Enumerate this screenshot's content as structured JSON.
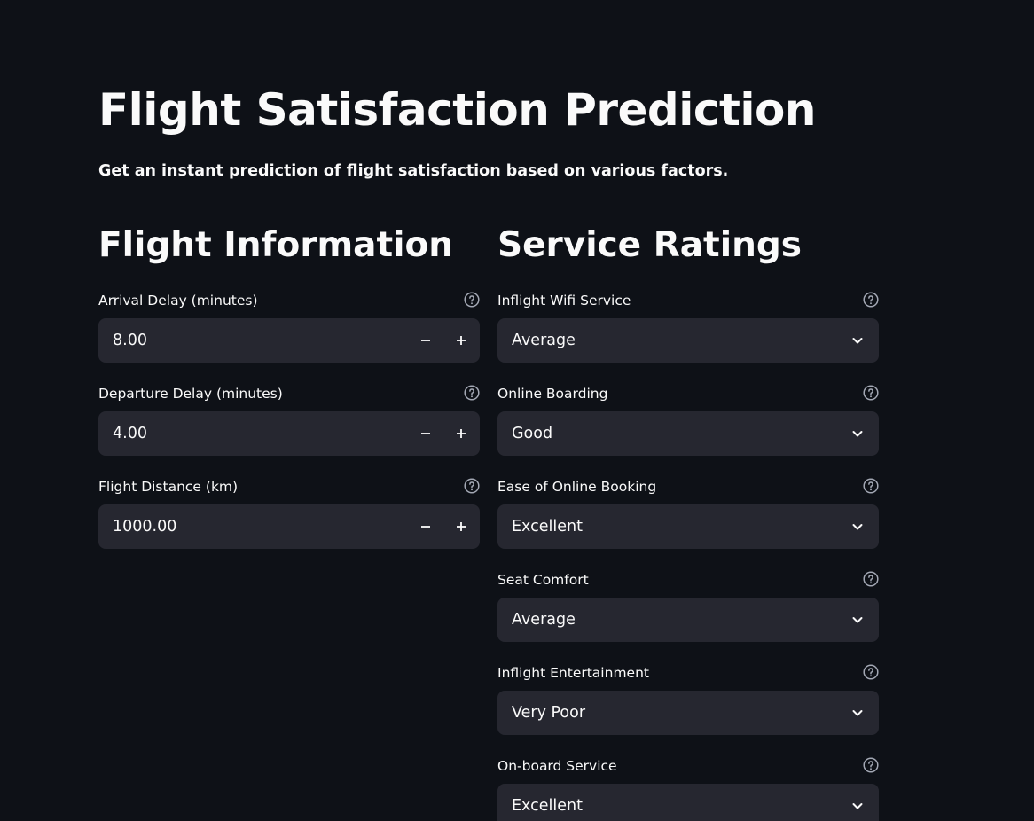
{
  "header": {
    "title": "Flight Satisfaction Prediction",
    "subtitle": "Get an instant prediction of flight satisfaction based on various factors."
  },
  "flight_info": {
    "heading": "Flight Information",
    "fields": [
      {
        "label": "Arrival Delay (minutes)",
        "value": "8.00"
      },
      {
        "label": "Departure Delay (minutes)",
        "value": "4.00"
      },
      {
        "label": "Flight Distance (km)",
        "value": "1000.00"
      }
    ]
  },
  "service_ratings": {
    "heading": "Service Ratings",
    "fields": [
      {
        "label": "Inflight Wifi Service",
        "value": "Average"
      },
      {
        "label": "Online Boarding",
        "value": "Good"
      },
      {
        "label": "Ease of Online Booking",
        "value": "Excellent"
      },
      {
        "label": "Seat Comfort",
        "value": "Average"
      },
      {
        "label": "Inflight Entertainment",
        "value": "Very Poor"
      },
      {
        "label": "On-board Service",
        "value": "Excellent"
      }
    ]
  },
  "icons": {
    "help": "question-circle-icon",
    "minus": "minus-icon",
    "plus": "plus-icon",
    "dropdown": "chevron-down-icon"
  },
  "colors": {
    "background": "#0e1117",
    "input_background": "#262730",
    "text": "#fafafa",
    "icon_muted": "#a3a8b4"
  }
}
